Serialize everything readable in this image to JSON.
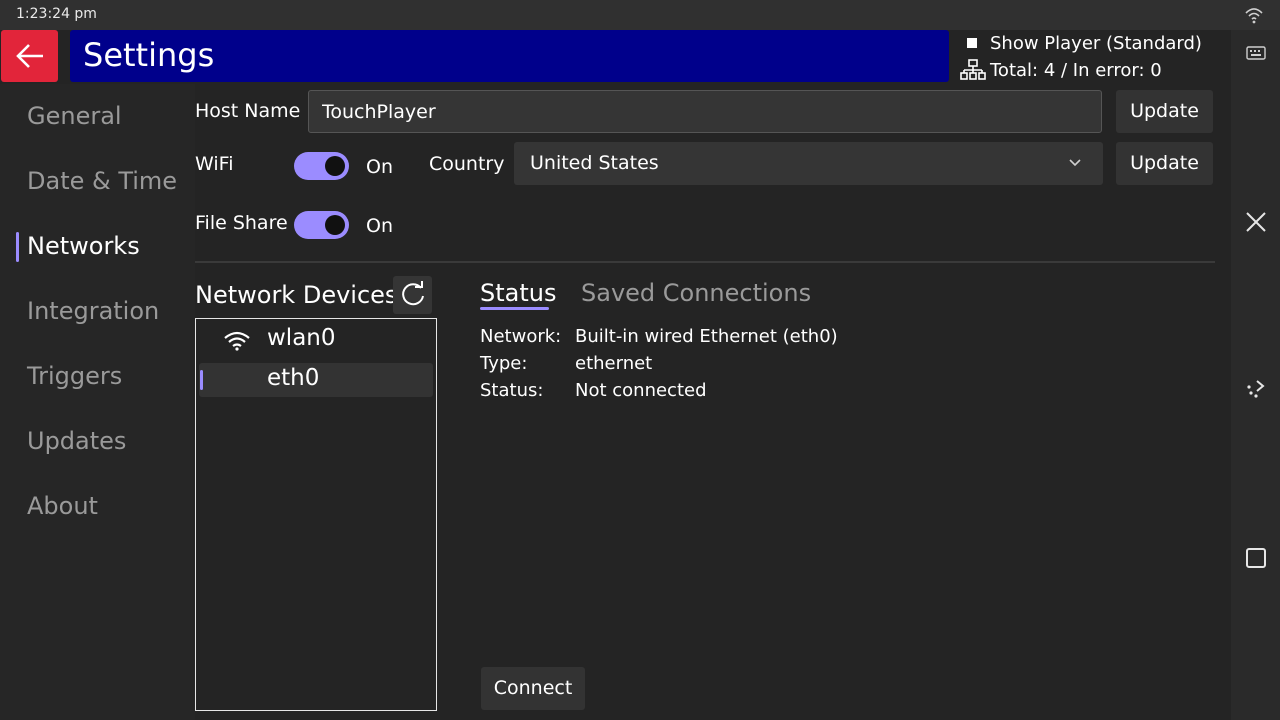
{
  "status_bar": {
    "time": "1:23:24 pm"
  },
  "header": {
    "title": "Settings",
    "show_player_label": "Show Player (Standard)",
    "totals_text": "Total: 4 / In error: 0"
  },
  "sidebar": {
    "items": [
      {
        "label": "General"
      },
      {
        "label": "Date & Time"
      },
      {
        "label": "Networks",
        "active": true
      },
      {
        "label": "Integration"
      },
      {
        "label": "Triggers"
      },
      {
        "label": "Updates"
      },
      {
        "label": "About"
      }
    ]
  },
  "settings": {
    "host_name_label": "Host Name",
    "host_name_value": "TouchPlayer",
    "host_update_label": "Update",
    "wifi_label": "WiFi",
    "wifi_state": "On",
    "country_label": "Country",
    "country_value": "United States",
    "country_update_label": "Update",
    "file_share_label": "File Share",
    "file_share_state": "On"
  },
  "devices": {
    "title": "Network Devices",
    "items": [
      {
        "label": "wlan0",
        "icon": "wifi-icon"
      },
      {
        "label": "eth0",
        "selected": true
      }
    ]
  },
  "tabs": [
    {
      "label": "Status",
      "active": true
    },
    {
      "label": "Saved Connections"
    }
  ],
  "status": {
    "network_key": "Network:",
    "network_value": "Built-in wired Ethernet (eth0)",
    "type_key": "Type:",
    "type_value": "ethernet",
    "status_key": "Status:",
    "status_value": "Not connected"
  },
  "connect_label": "Connect",
  "colors": {
    "accent": "#9b8cff",
    "back_button": "#e2253a",
    "title_bar": "#00008b",
    "background": "#242424"
  }
}
